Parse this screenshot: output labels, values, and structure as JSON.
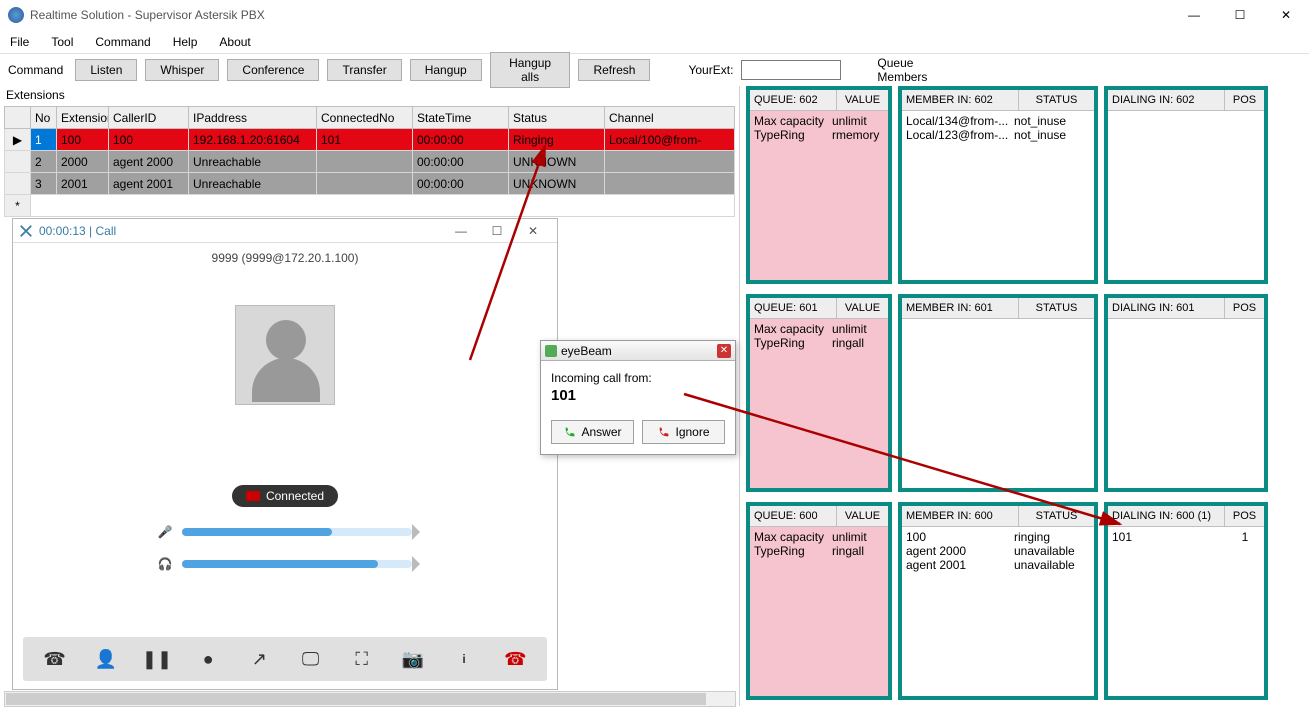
{
  "window": {
    "title": "Realtime Solution - Supervisor Astersik PBX"
  },
  "menu": {
    "file": "File",
    "tool": "Tool",
    "command": "Command",
    "help": "Help",
    "about": "About"
  },
  "toolbar": {
    "command": "Command",
    "listen": "Listen",
    "whisper": "Whisper",
    "conference": "Conference",
    "transfer": "Transfer",
    "hangup": "Hangup",
    "hangup_alls": "Hangup alls",
    "refresh": "Refresh",
    "your_ext": "YourExt:",
    "your_ext_value": ""
  },
  "sections": {
    "extensions": "Extensions",
    "queue_members": "Queue Members"
  },
  "ext_headers": {
    "no": "No",
    "extension": "Extension",
    "callerid": "CallerID",
    "ip": "IPaddress",
    "connected": "ConnectedNo",
    "statetime": "StateTime",
    "status": "Status",
    "channel": "Channel"
  },
  "ext_rows": [
    {
      "ptr": "▶",
      "no": "1",
      "ext": "100",
      "cid": "100",
      "ip": "192.168.1.20:61604",
      "conn": "101",
      "time": "00:00:00",
      "status": "Ringing",
      "chan": "Local/100@from-"
    },
    {
      "ptr": "",
      "no": "2",
      "ext": "2000",
      "cid": "agent 2000",
      "ip": "Unreachable",
      "conn": "",
      "time": "00:00:00",
      "status": "UNKNOWN",
      "chan": ""
    },
    {
      "ptr": "",
      "no": "3",
      "ext": "2001",
      "cid": "agent 2001",
      "ip": "Unreachable",
      "conn": "",
      "time": "00:00:00",
      "status": "UNKNOWN",
      "chan": ""
    }
  ],
  "softphone": {
    "title_time": "00:00:13",
    "title_call": "Call",
    "header": "9999 (9999@172.20.1.100)",
    "connected": "Connected",
    "mic_fill": 65,
    "spk_fill": 85
  },
  "eyebeam": {
    "title": "eyeBeam",
    "label": "Incoming call from:",
    "number": "101",
    "answer": "Answer",
    "ignore": "Ignore"
  },
  "queues": [
    {
      "queue_hdr": "QUEUE: 602",
      "value_hdr": "VALUE",
      "props": [
        [
          "Max capacity",
          "unlimit"
        ],
        [
          "TypeRing",
          "rmemory"
        ]
      ],
      "member_hdr": "MEMBER IN: 602",
      "status_hdr": "STATUS",
      "members": [
        [
          "Local/134@from-...",
          "not_inuse"
        ],
        [
          "Local/123@from-...",
          "not_inuse"
        ]
      ],
      "dial_hdr": "DIALING IN: 602",
      "pos_hdr": "POS",
      "dials": []
    },
    {
      "queue_hdr": "QUEUE: 601",
      "value_hdr": "VALUE",
      "props": [
        [
          "Max capacity",
          "unlimit"
        ],
        [
          "TypeRing",
          "ringall"
        ]
      ],
      "member_hdr": "MEMBER IN: 601",
      "status_hdr": "STATUS",
      "members": [],
      "dial_hdr": "DIALING IN: 601",
      "pos_hdr": "POS",
      "dials": []
    },
    {
      "queue_hdr": "QUEUE: 600",
      "value_hdr": "VALUE",
      "props": [
        [
          "Max capacity",
          "unlimit"
        ],
        [
          "TypeRing",
          "ringall"
        ]
      ],
      "member_hdr": "MEMBER IN: 600",
      "status_hdr": "STATUS",
      "members": [
        [
          "100",
          "ringing"
        ],
        [
          "agent 2000",
          "unavailable"
        ],
        [
          "agent 2001",
          "unavailable"
        ]
      ],
      "dial_hdr": "DIALING IN: 600 (1)",
      "pos_hdr": "POS",
      "dials": [
        [
          "101",
          "1"
        ]
      ]
    }
  ]
}
